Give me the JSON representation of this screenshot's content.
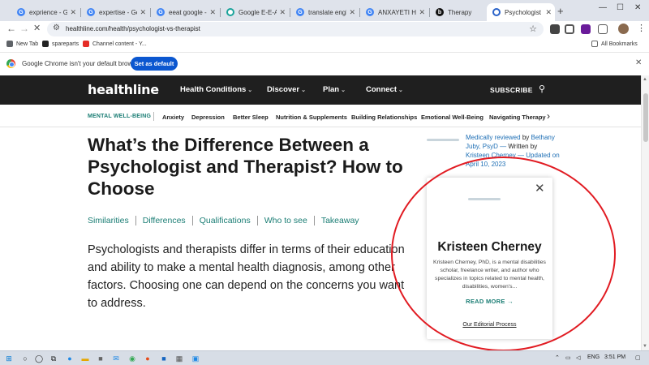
{
  "browser": {
    "tabs": [
      {
        "title": "exprience - Goo",
        "active": false
      },
      {
        "title": "expertise - Goog",
        "active": false
      },
      {
        "title": "eeat google - G",
        "active": false
      },
      {
        "title": "Google E-E-A-T",
        "active": false
      },
      {
        "title": "translate englis",
        "active": false
      },
      {
        "title": "ANXAYETI HEAD",
        "active": false
      },
      {
        "title": "Therapy",
        "active": false
      },
      {
        "title": "Psychologist vs",
        "active": true
      }
    ],
    "new_tab_symbol": "+",
    "url": "healthline.com/health/psychologist-vs-therapist",
    "bookmarks": [
      {
        "label": "New Tab"
      },
      {
        "label": "spareparts"
      },
      {
        "label": "Channel content - Y..."
      }
    ],
    "all_bookmarks_label": "All Bookmarks",
    "infobar": {
      "message": "Google Chrome isn't your default browser",
      "button_label": "Set as default"
    }
  },
  "site": {
    "logo": "healthline",
    "nav": [
      {
        "label": "Health Conditions"
      },
      {
        "label": "Discover"
      },
      {
        "label": "Plan"
      },
      {
        "label": "Connect"
      }
    ],
    "subscribe_label": "SUBSCRIBE",
    "subnav": {
      "category": "MENTAL WELL-BEING",
      "items": [
        "Anxiety",
        "Depression",
        "Better Sleep",
        "Nutrition & Supplements",
        "Building Relationships",
        "Emotional Well-Being",
        "Navigating Therapy"
      ]
    }
  },
  "article": {
    "headline": "What’s the Difference Between a Psychologist and Therapist? How to Choose",
    "toc": [
      "Similarities",
      "Differences",
      "Qualifications",
      "Who to see",
      "Takeaway"
    ],
    "intro": "Psychologists and therapists differ in terms of their education and ability to make a mental health diagnosis, among other factors. Choosing one can depend on the concerns you want to address.",
    "byline": {
      "reviewed_label": "Medically reviewed",
      "by": "by",
      "reviewer": "Bethany Juby, PsyD",
      "dash": "—",
      "written_by": "Written by",
      "author": "Kristeen Cherney",
      "updated": "— Updated on April 10, 2023"
    }
  },
  "author_popup": {
    "name": "Kristeen Cherney",
    "bio": "Kristeen Cherney, PhD, is a mental disabilities scholar, freelance writer, and author who specializes in topics related to mental health, disabilities, women's...",
    "read_more": "READ MORE",
    "editorial_link": "Our Editorial Process",
    "close_symbol": "✕"
  },
  "taskbar": {
    "language": "ENG",
    "time": "3:51 PM"
  },
  "colors": {
    "brand_dark": "#1f1f1f",
    "teal": "#1a7d74",
    "link_blue": "#1e6fb5",
    "annotation_red": "#e11b22",
    "chrome_blue": "#0b57d0"
  },
  "icons": [
    "search-icon",
    "close-icon",
    "chevron-down-icon",
    "arrow-right-icon",
    "star-icon",
    "back-icon",
    "forward-icon",
    "reload-icon"
  ]
}
